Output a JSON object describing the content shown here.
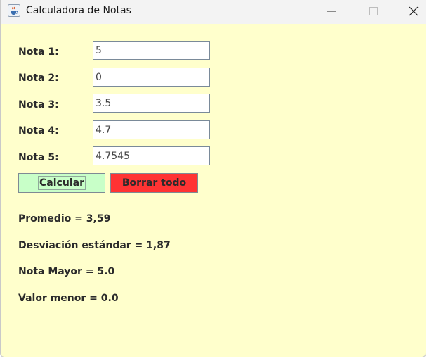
{
  "window": {
    "title": "Calculadora de Notas",
    "icon": "java-cup-icon"
  },
  "colors": {
    "background": "#ffffcc",
    "calc_button": "#c8ffc8",
    "clear_button": "#ff3333"
  },
  "grades": [
    {
      "label": "Nota 1:",
      "value": "5"
    },
    {
      "label": "Nota 2:",
      "value": "0"
    },
    {
      "label": "Nota 3:",
      "value": "3.5"
    },
    {
      "label": "Nota 4:",
      "value": "4.7"
    },
    {
      "label": "Nota 5:",
      "value": "4.7545"
    }
  ],
  "buttons": {
    "calculate": "Calcular",
    "clear": "Borrar todo"
  },
  "results": {
    "average": "Promedio = 3,59",
    "std_dev": "Desviación estándar = 1,87",
    "max": "Nota Mayor = 5.0",
    "min": "Valor menor = 0.0"
  }
}
